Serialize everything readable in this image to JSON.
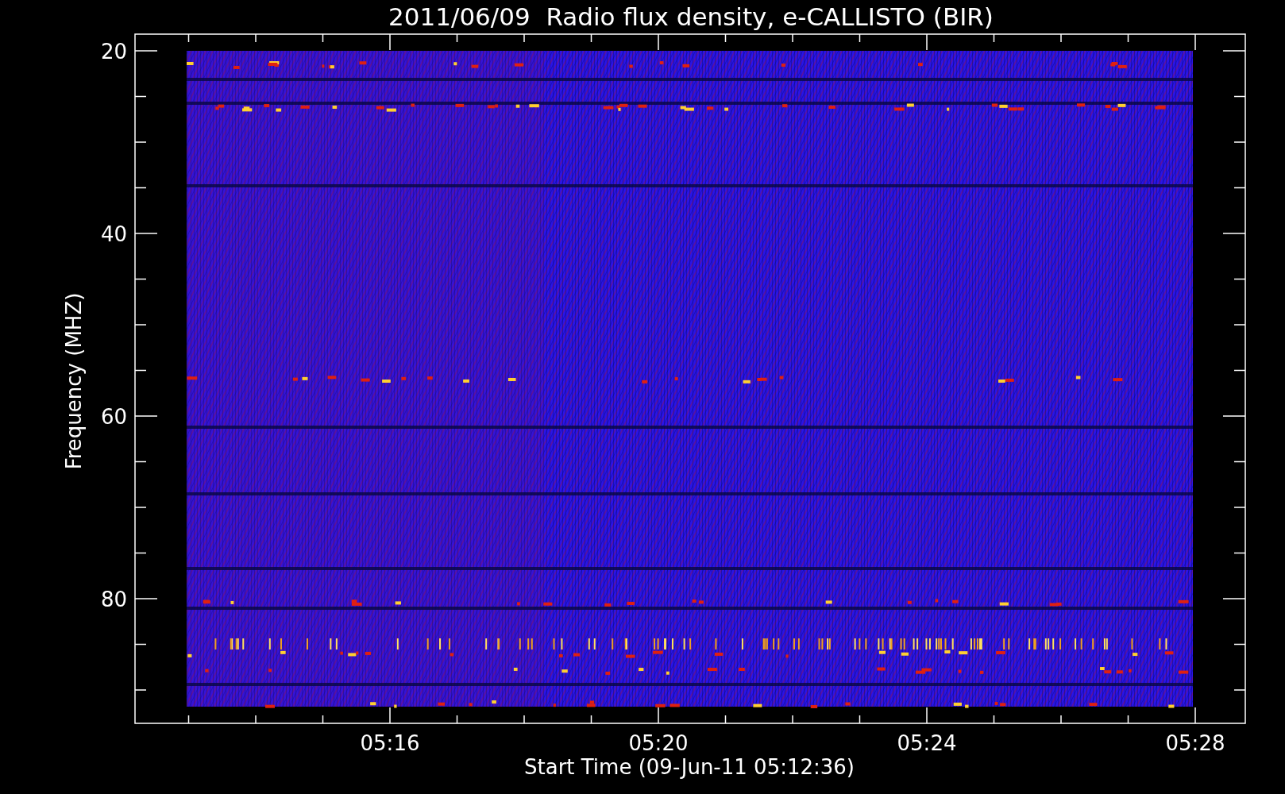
{
  "plot": {
    "title": "2011/06/09  Radio flux density, e-CALLISTO (BIR)",
    "ylabel": "Frequency (MHZ)",
    "xlabel": "Start Time (09-Jun-11 05:12:36)",
    "yticks": [
      {
        "label": "20"
      },
      {
        "label": "40"
      },
      {
        "label": "60"
      },
      {
        "label": "80"
      }
    ],
    "xticks": [
      {
        "label": "05:16"
      },
      {
        "label": "05:20"
      },
      {
        "label": "05:24"
      },
      {
        "label": "05:28"
      }
    ]
  }
}
